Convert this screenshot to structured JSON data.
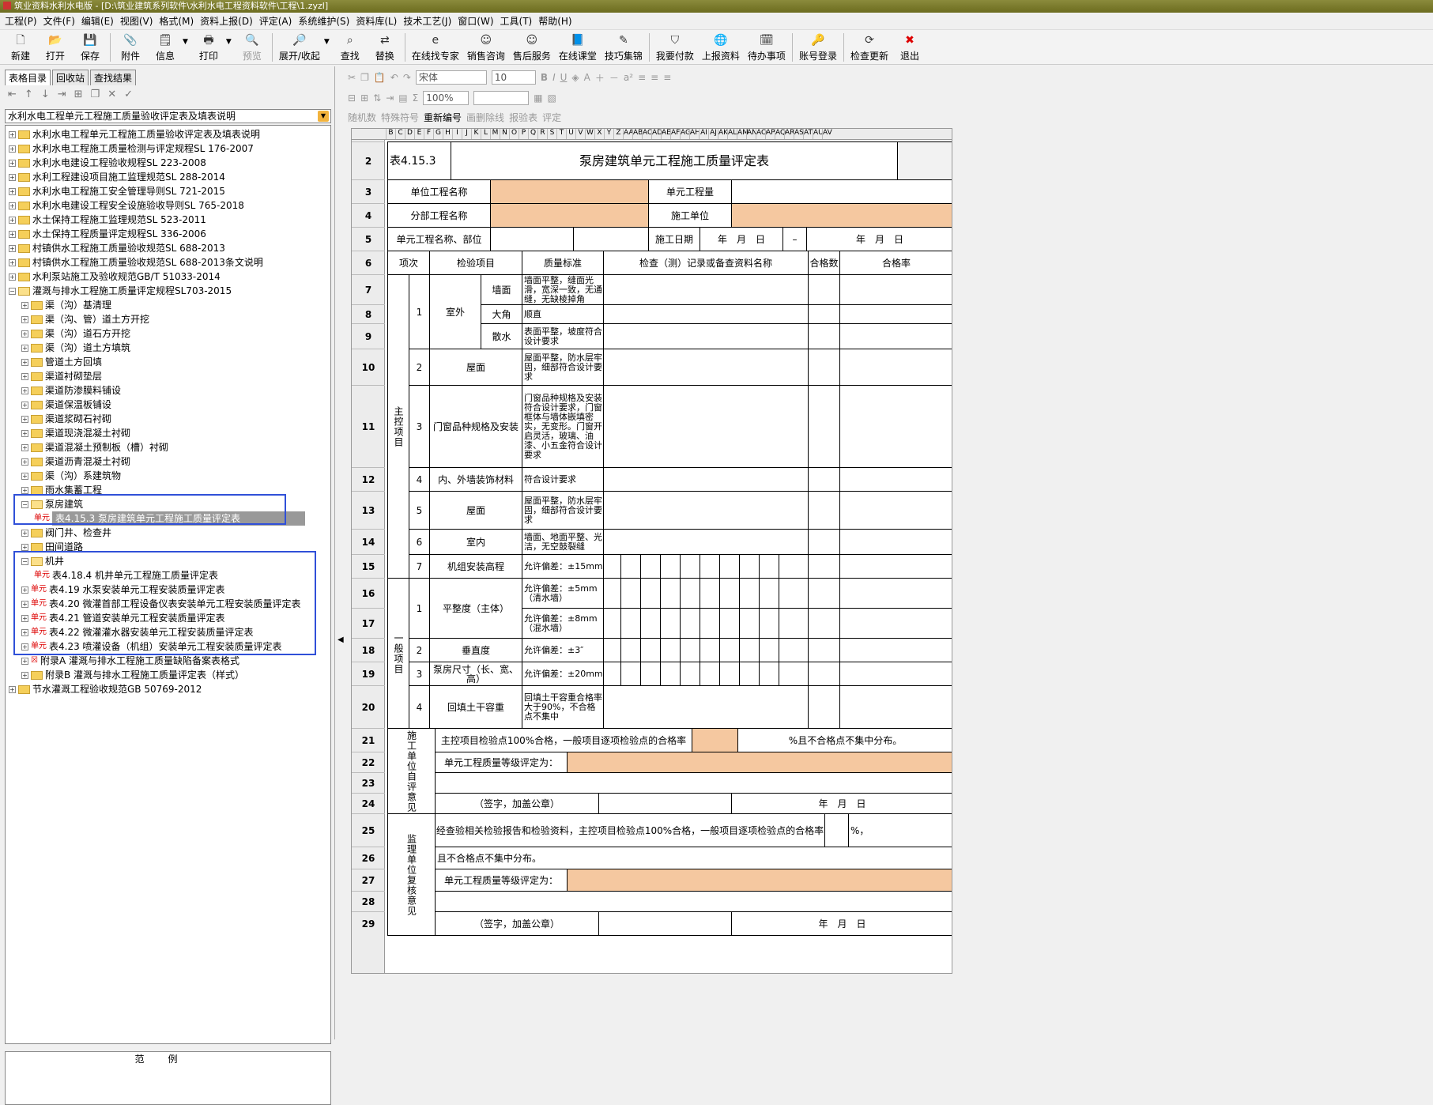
{
  "window": {
    "title": "筑业资料水利水电版 - [D:\\筑业建筑系列软件\\水利水电工程资料软件\\工程\\1.zyzl]"
  },
  "menu": [
    "工程(P)",
    "文件(F)",
    "编辑(E)",
    "视图(V)",
    "格式(M)",
    "资料上报(D)",
    "评定(A)",
    "系统维护(S)",
    "资料库(L)",
    "技术工艺(J)",
    "窗口(W)",
    "工具(T)",
    "帮助(H)"
  ],
  "toolbar": {
    "new": "新建",
    "open": "打开",
    "save": "保存",
    "attach": "附件",
    "info": "信息",
    "print": "打印",
    "preview": "预览",
    "expand": "展开/收起",
    "find": "查找",
    "replace": "替换",
    "expert": "在线找专家",
    "sales": "销售咨询",
    "aftersales": "售后服务",
    "classroom": "在线课堂",
    "tips": "技巧集锦",
    "pay": "我要付款",
    "upload": "上报资料",
    "todo": "待办事项",
    "login": "账号登录",
    "update": "检查更新",
    "exit": "退出"
  },
  "format": {
    "font": "宋体",
    "size": "10",
    "zoom": "100%",
    "random": "随机数",
    "special": "特殊符号",
    "renumber": "重新编号",
    "delline": "画删除线",
    "report": "报验表",
    "evaluate": "评定"
  },
  "panel": {
    "tabs": [
      "表格目录",
      "回收站",
      "查找结果"
    ],
    "combo": "水利水电工程单元工程施工质量验收评定表及填表说明",
    "legend": "范例"
  },
  "tree": [
    {
      "t": "水利水电工程单元工程施工质量验收评定表及填表说明",
      "lv": 0,
      "k": "f"
    },
    {
      "t": "水利水电工程施工质量检测与评定规程SL 176-2007",
      "lv": 0,
      "k": "f"
    },
    {
      "t": "水利水电建设工程验收规程SL 223-2008",
      "lv": 0,
      "k": "f"
    },
    {
      "t": "水利工程建设项目施工监理规范SL 288-2014",
      "lv": 0,
      "k": "f"
    },
    {
      "t": "水利水电工程施工安全管理导则SL 721-2015",
      "lv": 0,
      "k": "f"
    },
    {
      "t": "水利水电建设工程安全设施验收导则SL 765-2018",
      "lv": 0,
      "k": "f"
    },
    {
      "t": "水土保持工程施工监理规范SL 523-2011",
      "lv": 0,
      "k": "f"
    },
    {
      "t": "水土保持工程质量评定规程SL 336-2006",
      "lv": 0,
      "k": "f"
    },
    {
      "t": "村镇供水工程施工质量验收规范SL 688-2013",
      "lv": 0,
      "k": "f"
    },
    {
      "t": "村镇供水工程施工质量验收规范SL 688-2013条文说明",
      "lv": 0,
      "k": "f"
    },
    {
      "t": "水利泵站施工及验收规范GB/T 51033-2014",
      "lv": 0,
      "k": "f"
    },
    {
      "t": "灌溉与排水工程施工质量评定规程SL703-2015",
      "lv": 0,
      "k": "o"
    },
    {
      "t": "渠（沟）基清理",
      "lv": 1,
      "k": "f"
    },
    {
      "t": "渠（沟、管）道土方开挖",
      "lv": 1,
      "k": "f"
    },
    {
      "t": "渠（沟）道石方开挖",
      "lv": 1,
      "k": "f"
    },
    {
      "t": "渠（沟）道土方填筑",
      "lv": 1,
      "k": "f"
    },
    {
      "t": "管道土方回填",
      "lv": 1,
      "k": "f"
    },
    {
      "t": "渠道衬砌垫层",
      "lv": 1,
      "k": "f"
    },
    {
      "t": "渠道防渗膜料铺设",
      "lv": 1,
      "k": "f"
    },
    {
      "t": "渠道保温板铺设",
      "lv": 1,
      "k": "f"
    },
    {
      "t": "渠道浆砌石衬砌",
      "lv": 1,
      "k": "f"
    },
    {
      "t": "渠道现浇混凝土衬砌",
      "lv": 1,
      "k": "f"
    },
    {
      "t": "渠道混凝土预制板（槽）衬砌",
      "lv": 1,
      "k": "f"
    },
    {
      "t": "渠道沥青混凝土衬砌",
      "lv": 1,
      "k": "f"
    },
    {
      "t": "渠（沟）系建筑物",
      "lv": 1,
      "k": "f"
    },
    {
      "t": "雨水集蓄工程",
      "lv": 1,
      "k": "f"
    },
    {
      "t": "泵房建筑",
      "lv": 1,
      "k": "o"
    },
    {
      "t": "表4.15.3 泵房建筑单元工程施工质量评定表",
      "lv": 2,
      "k": "d",
      "sel": true
    },
    {
      "t": "阀门井、检查井",
      "lv": 1,
      "k": "f"
    },
    {
      "t": "田间道路",
      "lv": 1,
      "k": "f"
    },
    {
      "t": "机井",
      "lv": 1,
      "k": "o"
    },
    {
      "t": "表4.18.4 机井单元工程施工质量评定表",
      "lv": 2,
      "k": "d"
    },
    {
      "t": "表4.19 水泵安装单元工程安装质量评定表",
      "lv": 1,
      "k": "d"
    },
    {
      "t": "表4.20 微灌首部工程设备仪表安装单元工程安装质量评定表",
      "lv": 1,
      "k": "d"
    },
    {
      "t": "表4.21 管道安装单元工程安装质量评定表",
      "lv": 1,
      "k": "d"
    },
    {
      "t": "表4.22 微灌灌水器安装单元工程安装质量评定表",
      "lv": 1,
      "k": "d"
    },
    {
      "t": "表4.23 喷灌设备（机组）安装单元工程安装质量评定表",
      "lv": 1,
      "k": "d"
    },
    {
      "t": "附录A 灌溉与排水工程施工质量缺陷备案表格式",
      "lv": 1,
      "k": "x"
    },
    {
      "t": "附录B 灌溉与排水工程施工质量评定表（样式）",
      "lv": 1,
      "k": "f"
    },
    {
      "t": "节水灌溉工程验收规范GB 50769-2012",
      "lv": 0,
      "k": "f"
    }
  ],
  "sheet": {
    "cols": [
      "B",
      "C",
      "D",
      "E",
      "F",
      "G",
      "H",
      "I",
      "J",
      "K",
      "L",
      "M",
      "N",
      "O",
      "P",
      "Q",
      "R",
      "S",
      "T",
      "U",
      "V",
      "W",
      "X",
      "Y",
      "Z",
      "AA",
      "AB",
      "AC",
      "AD",
      "AE",
      "AF",
      "AG",
      "AH",
      "AI",
      "AJ",
      "AK",
      "AL",
      "AM",
      "AN",
      "AO",
      "AP",
      "AQ",
      "AR",
      "AS",
      "AT",
      "AU",
      "AV"
    ],
    "rows": [
      "2",
      "3",
      "4",
      "5",
      "6",
      "7",
      "8",
      "9",
      "10",
      "11",
      "12",
      "13",
      "14",
      "15",
      "16",
      "17",
      "18",
      "19",
      "20",
      "21",
      "22",
      "23",
      "24",
      "25",
      "26",
      "27",
      "28",
      "29"
    ],
    "table_no": "表4.15.3",
    "title": "泵房建筑单元工程施工质量评定表",
    "unit_project": "单位工程名称",
    "unit_qty": "单元工程量",
    "sub_project": "分部工程名称",
    "contractor": "施工单位",
    "unit_name": "单元工程名称、部位",
    "date_label": "施工日期",
    "date_fmt": "年　月　日",
    "dash": "–",
    "h_item": "项次",
    "h_check": "检验项目",
    "h_std": "质量标准",
    "h_record": "检查（测）记录或备查资料名称",
    "h_pass": "合格数",
    "h_rate": "合格率",
    "main_group": "主控项目",
    "general_group": "一般项目",
    "r7_no": "1",
    "r7_cat": "室外",
    "r7_sub": "墙面",
    "r7_std": "墙面平整，缝面光滑，宽深一致，无通缝，无缺棱掉角",
    "r8_sub": "大角",
    "r8_std": "顺直",
    "r9_sub": "散水",
    "r9_std": "表面平整，坡度符合设计要求",
    "r10_no": "2",
    "r10_item": "屋面",
    "r10_std": "屋面平整，防水层牢固，细部符合设计要求",
    "r11_no": "3",
    "r11_item": "门窗品种规格及安装",
    "r11_std": "门窗品种规格及安装符合设计要求，门窗框体与墙体嵌填密实，无变形。门窗开启灵活，玻璃、油漆、小五金符合设计要求",
    "r12_no": "4",
    "r12_item": "内、外墙装饰材料",
    "r12_std": "符合设计要求",
    "r13_no": "5",
    "r13_item": "屋面",
    "r13_std": "屋面平整，防水层牢固，细部符合设计要求",
    "r14_no": "6",
    "r14_item": "室内",
    "r14_std": "墙面、地面平整、光洁，无空鼓裂缝",
    "r15_no": "7",
    "r15_item": "机组安装高程",
    "r15_std": "允许偏差：±15mm",
    "r16_no": "1",
    "r16_item": "平整度（主体）",
    "r16_std": "允许偏差：±5mm（清水墙）",
    "r17_std": "允许偏差：±8mm（混水墙）",
    "r18_no": "2",
    "r18_item": "垂直度",
    "r18_std": "允许偏差：±3″",
    "r19_no": "3",
    "r19_item": "泵房尺寸（长、宽、高）",
    "r19_std": "允许偏差：±20mm",
    "r20_no": "4",
    "r20_item": "回填土干容重",
    "r20_std": "回填土干容重合格率大于90%，不合格点不集中",
    "self_group": "施工单位自评意见",
    "r21_text": "主控项目检验点100%合格，一般项目逐项检验点的合格率",
    "r21_tail": "%且不合格点不集中分布。",
    "r22_text": "单元工程质量等级评定为：",
    "sign": "（签字，加盖公章）",
    "super_group": "监理单位复核意见",
    "r25_text": "经查验相关检验报告和检验资料，主控项目检验点100%合格，一般项目逐项检验点的合格率",
    "r25_tail": "%，",
    "r26_text": "且不合格点不集中分布。",
    "r27_text": "单元工程质量等级评定为："
  },
  "colors": {
    "peach": "#f5c8a0",
    "select": "#3050d8"
  }
}
